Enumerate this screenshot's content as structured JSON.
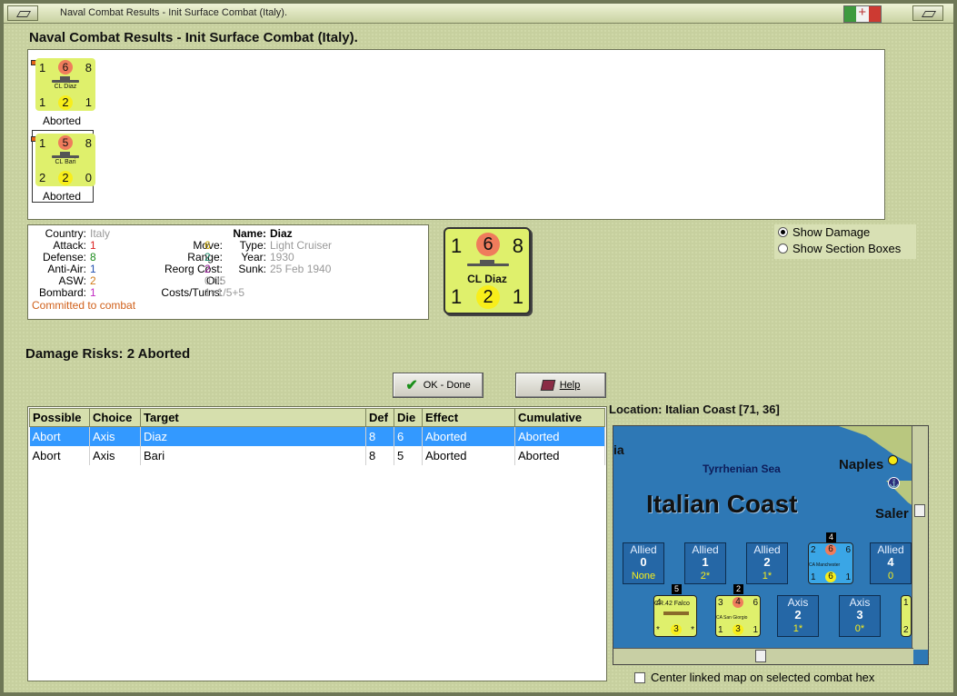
{
  "window": {
    "title": "Naval Combat Results - Init Surface Combat (Italy).",
    "flag_colors": [
      "#3e9a3e",
      "#f2f2f2",
      "#cd3a32"
    ]
  },
  "header": {
    "title": "Naval Combat Results - Init Surface Combat (Italy)."
  },
  "units": [
    {
      "tl": "1",
      "tc": "6",
      "tr": "8",
      "name": "CL Diaz",
      "bl": "1",
      "bc": "2",
      "br": "1",
      "status": "Aborted"
    },
    {
      "tl": "1",
      "tc": "5",
      "tr": "8",
      "name": "CL Bari",
      "bl": "2",
      "bc": "2",
      "br": "0",
      "status": "Aborted"
    }
  ],
  "info": {
    "country_label": "Country:",
    "country": "Italy",
    "attack_label": "Attack:",
    "attack": "1",
    "defense_label": "Defense:",
    "defense": "8",
    "antiair_label": "Anti-Air:",
    "antiair": "1",
    "asw_label": "ASW:",
    "asw": "2",
    "bombard_label": "Bombard:",
    "bombard": "1",
    "committed": "Committed to combat",
    "name_label": "Name:",
    "name": "Diaz",
    "move_label": "Move:",
    "move": "6",
    "type_label": "Type:",
    "type": "Light Cruiser",
    "range_label": "Range:",
    "range": "2",
    "year_label": "Year:",
    "year": "1930",
    "reorg_label": "Reorg Cost:",
    "reorg": "2",
    "sunk_label": "Sunk:",
    "sunk": "25 Feb 1940",
    "oil_label": "Oil:",
    "oil": "0.05",
    "costs_label": "Costs/Turns:",
    "costs": "1+1/5+5"
  },
  "big_counter": {
    "tl": "1",
    "tc": "6",
    "tr": "8",
    "name": "CL Diaz",
    "bl": "1",
    "bc": "2",
    "br": "1"
  },
  "options": {
    "show_damage": "Show Damage",
    "show_sections": "Show Section Boxes"
  },
  "damage_risks": "Damage Risks:  2 Aborted",
  "buttons": {
    "ok": "OK - Done",
    "help": "Help"
  },
  "table": {
    "columns": [
      "Possible",
      "Choice",
      "Target",
      "Def",
      "Die",
      "Effect",
      "Cumulative"
    ],
    "rows": [
      [
        "Abort",
        "Axis",
        "Diaz",
        "8",
        "6",
        "Aborted",
        "Aborted"
      ],
      [
        "Abort",
        "Axis",
        "Bari",
        "8",
        "5",
        "Aborted",
        "Aborted"
      ]
    ]
  },
  "location": "Location:  Italian Coast [71, 36]",
  "map": {
    "sea_label": "Tyrrhenian Sea",
    "coast_label": "Italian Coast",
    "naples": "Naples",
    "salerno": "Saler",
    "edge_text": "ia",
    "allied_boxes": [
      {
        "side": "Allied",
        "num": "0",
        "sub": "None"
      },
      {
        "side": "Allied",
        "num": "1",
        "sub": "2*"
      },
      {
        "side": "Allied",
        "num": "2",
        "sub": "1*"
      },
      {
        "side": "Allied",
        "num": "4",
        "sub": "0"
      }
    ],
    "axis_boxes": [
      {
        "side": "Axis",
        "num": "2",
        "sub": "1*"
      },
      {
        "side": "Axis",
        "num": "3",
        "sub": "0*"
      }
    ],
    "manchester": {
      "tl": "2",
      "tc": "6",
      "tr": "6",
      "name": "CA Manchester",
      "bl": "1",
      "bc": "6",
      "br": "1",
      "stack": "4"
    },
    "falco": {
      "tl": "4",
      "name": "CR.42 Falco",
      "bl": "*",
      "bc": "3",
      "br": "*",
      "stack": "5"
    },
    "sangiorgio": {
      "tl": "3",
      "tc": "4",
      "tr": "6",
      "name": "CA San Giorgio",
      "bl": "1",
      "bc": "3",
      "br": "1",
      "stack": "2"
    },
    "edge_counter": {
      "t": "1",
      "b": "2"
    }
  },
  "center_map_label": "Center linked map on selected combat hex"
}
